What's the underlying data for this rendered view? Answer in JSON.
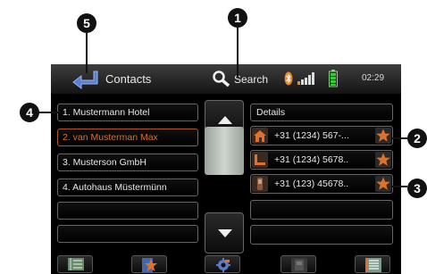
{
  "header": {
    "title": "Contacts",
    "search_label": "Search",
    "time": "02:29"
  },
  "contacts": [
    {
      "label": "1. Mustermann Hotel",
      "selected": false
    },
    {
      "label": "2. van Musterman Max",
      "selected": true
    },
    {
      "label": "3. Musterson GmbH",
      "selected": false
    },
    {
      "label": "4. Autohaus Müstermünn",
      "selected": false
    }
  ],
  "details": {
    "header": "Details",
    "entries": [
      {
        "icon": "home-icon",
        "number": "+31 (1234) 567-..."
      },
      {
        "icon": "office-icon",
        "number": "+31 (1234) 5678.."
      },
      {
        "icon": "mobile-phone-icon",
        "number": "+31 (123) 45678.."
      }
    ]
  },
  "bottom_bar": [
    "phonebook-icon",
    "favorites-icon",
    "bluetooth-settings-icon",
    "phone-icon",
    "call-list-icon"
  ],
  "callouts": [
    "1",
    "2",
    "3",
    "4",
    "5"
  ],
  "colors": {
    "accent": "#e0702a",
    "selected_text": "#d2722c",
    "background": "#000000"
  }
}
